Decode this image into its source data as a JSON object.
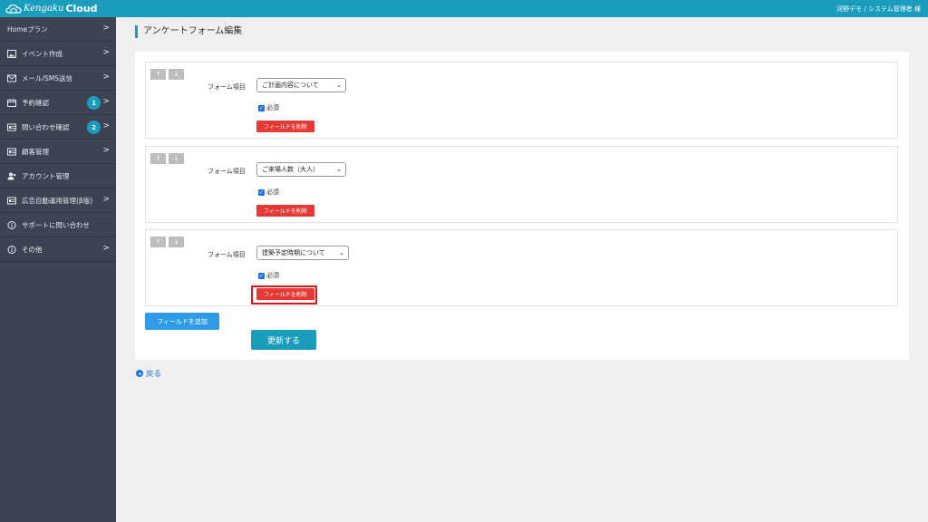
{
  "header": {
    "logo_text": "Kengaku",
    "logo_bold": "Cloud",
    "user": "河野デモ / システム管理者 様"
  },
  "sidebar": {
    "items": [
      {
        "label": "Homeプラン",
        "icon": "",
        "chevron": ">"
      },
      {
        "label": "イベント作成",
        "icon": "image-icon",
        "chevron": ">"
      },
      {
        "label": "メール/SMS送信",
        "icon": "mail-icon",
        "chevron": ">"
      },
      {
        "label": "予約確認",
        "icon": "calendar-icon",
        "chevron": ">",
        "badge": "1"
      },
      {
        "label": "問い合わせ確認",
        "icon": "id-card-icon",
        "chevron": ">",
        "badge": "2"
      },
      {
        "label": "顧客管理",
        "icon": "id-card-icon",
        "chevron": ">"
      },
      {
        "label": "アカウント管理",
        "icon": "users-icon"
      },
      {
        "label": "広告自動運用管理(β版)",
        "icon": "id-card-icon",
        "chevron": ">"
      },
      {
        "label": "サポートに問い合わせ",
        "icon": "info-icon"
      },
      {
        "label": "その他",
        "icon": "info-icon",
        "chevron": ">"
      }
    ]
  },
  "main": {
    "title": "アンケートフォーム編集",
    "fields": [
      {
        "label": "フォーム項目",
        "value": "ご計画内容について",
        "required": "必須",
        "up": "↑",
        "down": "↓",
        "delete": "フィールドを削除"
      },
      {
        "label": "フォーム項目",
        "value": "ご来場人数（大人）",
        "required": "必須",
        "up": "↑",
        "down": "↓",
        "delete": "フィールドを削除"
      },
      {
        "label": "フォーム項目",
        "value": "建築予定時期について",
        "required": "必須",
        "up": "↑",
        "down": "↓",
        "delete": "フィールドを削除"
      }
    ],
    "add_button": "フィールドを追加",
    "update_button": "更新する",
    "back_link": "戻る"
  },
  "colors": {
    "accent": "#1a9cbc",
    "sidebar": "#3c4353",
    "danger": "#e53935",
    "primary": "#2e9ae8",
    "highlight": "#e0151b"
  }
}
